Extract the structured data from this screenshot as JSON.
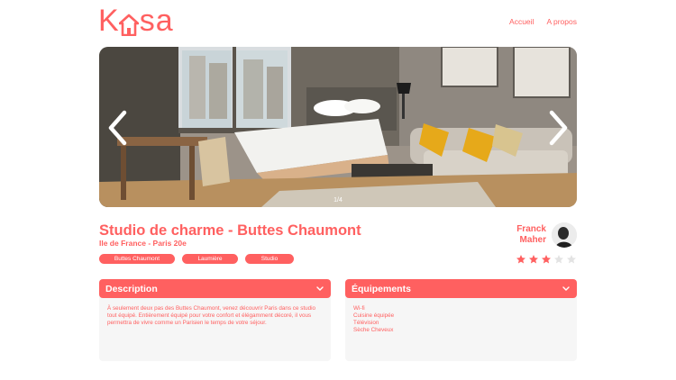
{
  "brand": {
    "logo_k": "K",
    "logo_sa": "sa",
    "accent": "#FF6060"
  },
  "nav": {
    "home": "Accueil",
    "about": "A propos"
  },
  "gallery": {
    "counter": "1/4"
  },
  "listing": {
    "title": "Studio de charme - Buttes Chaumont",
    "location": "Ile de France - Paris 20e",
    "tags": [
      "Buttes Chaumont",
      "Laumière",
      "Studio"
    ]
  },
  "host": {
    "first_name": "Franck",
    "last_name": "Maher"
  },
  "rating": {
    "value": 3,
    "max": 5,
    "filled_color": "#FF6060",
    "empty_color": "#E3E3E3"
  },
  "description": {
    "title": "Description",
    "text": "À seulement deux pas des Buttes Chaumont, venez découvrir Paris dans ce studio tout équipé. Entièrement équipé pour votre confort et élégamment décoré, il vous permettra de vivre comme un Parisien le temps de votre séjour."
  },
  "equipments": {
    "title": "Équipements",
    "items": [
      "Wi-fi",
      "Cuisine équipée",
      "Télévision",
      "Sèche Cheveux"
    ]
  }
}
